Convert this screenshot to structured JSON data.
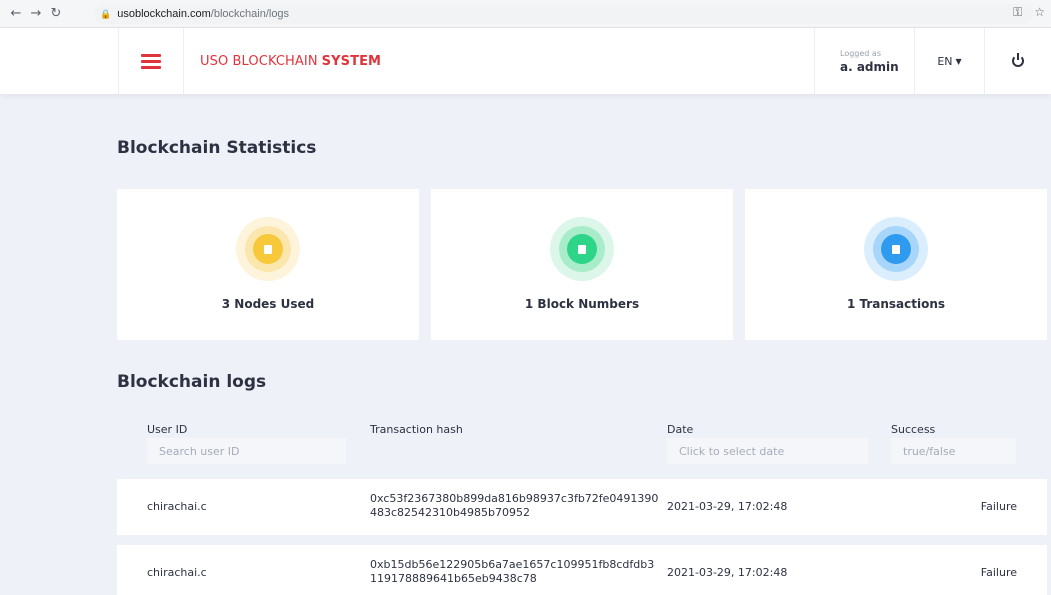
{
  "browser": {
    "url_host": "usoblockchain.com",
    "url_path": "/blockchain/logs"
  },
  "header": {
    "brand_prefix": "USO BLOCKCHAIN",
    "brand_bold": "SYSTEM",
    "logged_as_label": "Logged as",
    "username": "a. admin",
    "language": "EN"
  },
  "colors": {
    "accent": "#e0343c",
    "nodes": "#f7c83a",
    "blocks": "#2ed487",
    "transactions": "#2f9bef"
  },
  "stats": {
    "title": "Blockchain Statistics",
    "cards": [
      {
        "label": "3 Nodes Used",
        "icon": "node-icon"
      },
      {
        "label": "1 Block Numbers",
        "icon": "block-icon"
      },
      {
        "label": "1 Transactions",
        "icon": "transaction-icon"
      }
    ]
  },
  "logs": {
    "title": "Blockchain logs",
    "columns": {
      "user_id": "User ID",
      "hash": "Transaction hash",
      "date": "Date",
      "success": "Success"
    },
    "filters": {
      "user_placeholder": "Search user ID",
      "date_placeholder": "Click to select date",
      "success_placeholder": "true/false"
    },
    "rows": [
      {
        "user": "chirachai.c",
        "hash": "0xc53f2367380b899da816b98937c3fb72fe0491390483c82542310b4985b70952",
        "date": "2021-03-29, 17:02:48",
        "success": "Failure"
      },
      {
        "user": "chirachai.c",
        "hash": "0xb15db56e122905b6a7ae1657c109951fb8cdfdb3119178889641b65eb9438c78",
        "date": "2021-03-29, 17:02:48",
        "success": "Failure"
      }
    ]
  }
}
